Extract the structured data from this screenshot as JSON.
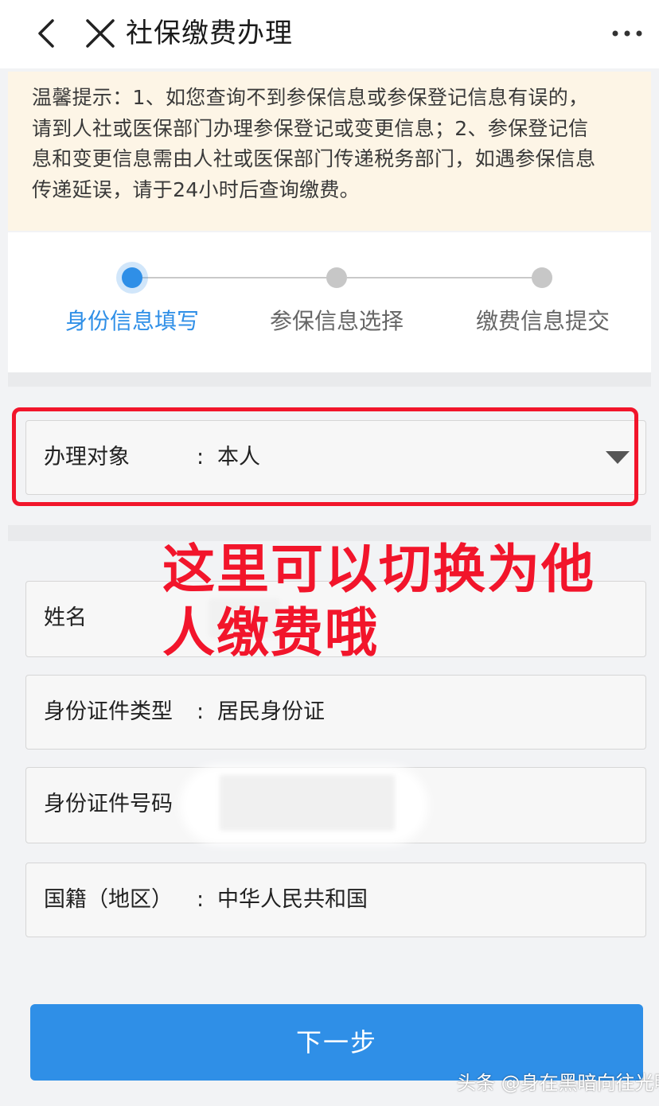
{
  "header": {
    "title": "社保缴费办理",
    "back_icon": "chevron-left-icon",
    "close_icon": "close-icon",
    "more_icon": "more-horizontal-icon"
  },
  "notice": {
    "lines": [
      "温馨提示：1、如您查询不到参保信息或参保登记信息有误的，",
      "请到人社或医保部门办理参保登记或变更信息；2、参保登记信",
      "息和变更信息需由人社或医保部门传递税务部门，如遇参保信息",
      "传递延误，请于24小时后查询缴费。"
    ]
  },
  "steps": [
    {
      "label": "身份信息填写",
      "active": true
    },
    {
      "label": "参保信息选择",
      "active": false
    },
    {
      "label": "缴费信息提交",
      "active": false
    }
  ],
  "form": {
    "target": {
      "label": "办理对象",
      "value": "本人"
    },
    "name": {
      "label": "姓名"
    },
    "id_type": {
      "label": "身份证件类型",
      "value": "居民身份证"
    },
    "id_number": {
      "label": "身份证件号码"
    },
    "nationality": {
      "label": "国籍（地区）",
      "value": "中华人民共和国"
    },
    "colon": ":"
  },
  "annotation": {
    "line1": "这里可以切换为他",
    "line2": "人缴费哦"
  },
  "next_button": "下一步",
  "watermark": "头条 @身在黑暗向往光明",
  "colors": {
    "primary": "#2f8fe7",
    "annotation_red": "#f2152b",
    "notice_bg": "#fdf5e6"
  }
}
